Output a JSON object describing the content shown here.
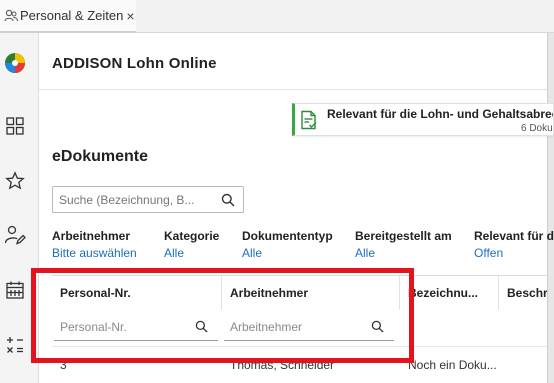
{
  "tab": {
    "label": "Personal & Zeiten"
  },
  "rail": {
    "items": [
      "logo-icon",
      "dashboard-icon",
      "star-icon",
      "person-edit-icon",
      "calendar-icon",
      "calculator-icon"
    ]
  },
  "header": {
    "title": "ADDISON Lohn Online"
  },
  "card": {
    "title": "Relevant für die Lohn- und Gehaltsabrech",
    "count": "6 Doku",
    "accent": "#3aa84a"
  },
  "page": {
    "title": "eDokumente"
  },
  "search": {
    "placeholder": "Suche (Bezeichnung, B..."
  },
  "filters": [
    {
      "label": "Arbeitnehmer",
      "value": "Bitte auswählen"
    },
    {
      "label": "Kategorie",
      "value": "Alle"
    },
    {
      "label": "Dokumententyp",
      "value": "Alle"
    },
    {
      "label": "Bereitgestellt am",
      "value": "Alle"
    },
    {
      "label": "Relevant für d",
      "value": "Offen"
    }
  ],
  "table": {
    "columns": [
      "Personal-Nr.",
      "Arbeitnehmer",
      "Bezeichnu...",
      "Beschre"
    ],
    "filter_placeholders": {
      "personal_nr": "Personal-Nr.",
      "arbeitnehmer": "Arbeitnehmer"
    },
    "rows": [
      {
        "personal_nr": "3",
        "arbeitnehmer": "Thomas, Schneider",
        "bezeichnung": "Noch ein Doku..."
      }
    ]
  },
  "colors": {
    "link": "#1d6fb8",
    "highlight": "#e3141d"
  }
}
